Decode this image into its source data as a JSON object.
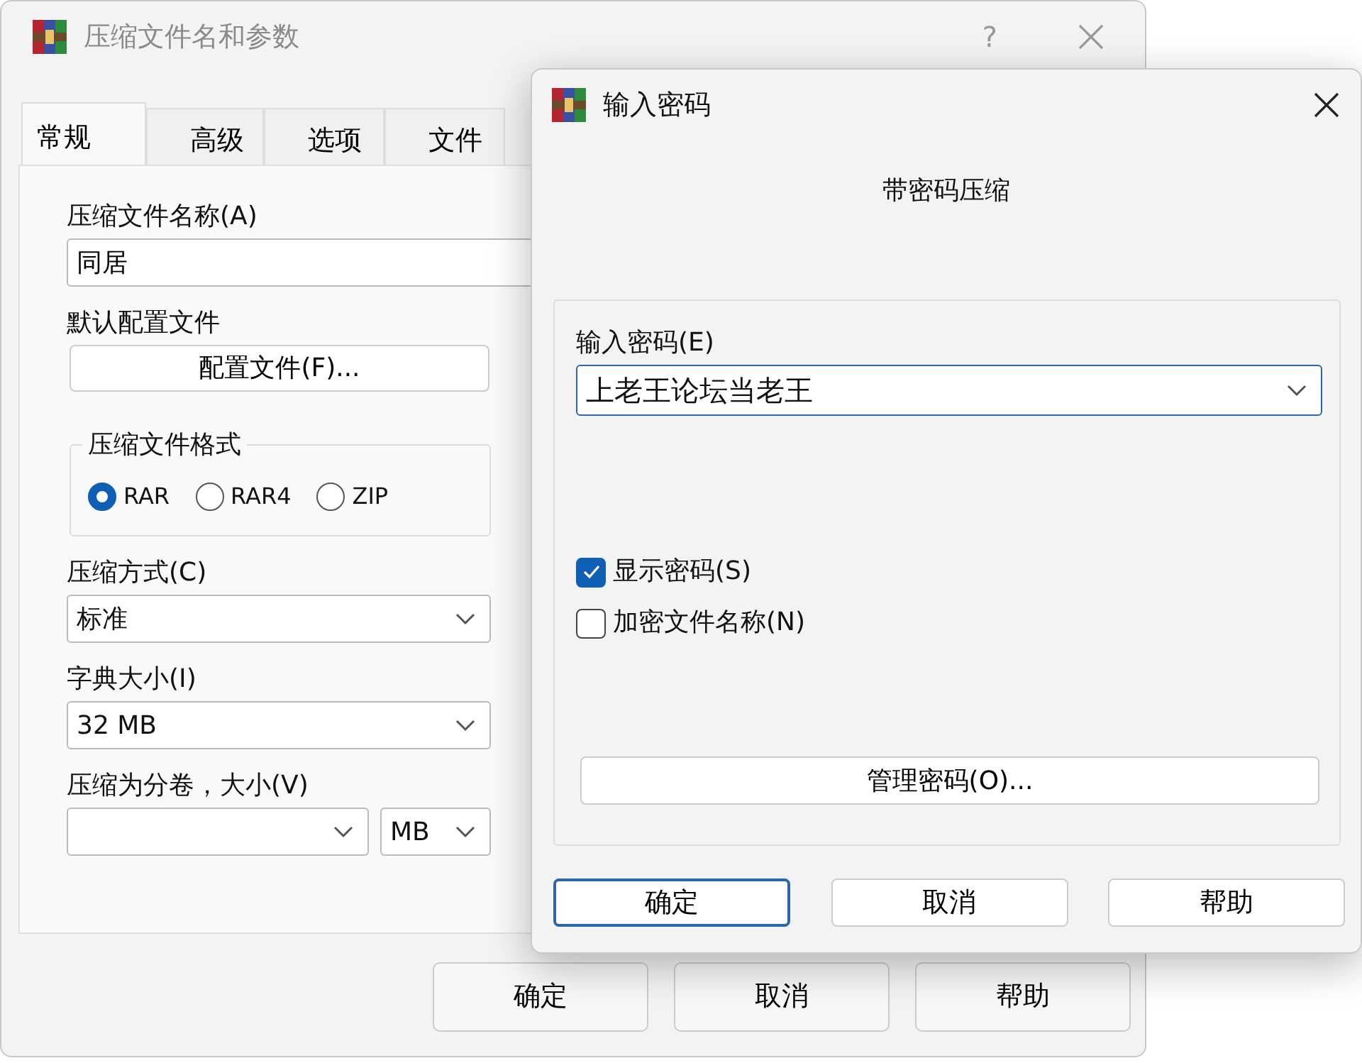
{
  "main_window": {
    "title": "压缩文件名和参数",
    "help_button": "?",
    "tabs": [
      {
        "label": "常规",
        "selected": true
      },
      {
        "label": "高级",
        "selected": false
      },
      {
        "label": "选项",
        "selected": false
      },
      {
        "label": "文件",
        "selected": false
      }
    ],
    "archive_name": {
      "label": "压缩文件名称(A)",
      "value": "同居"
    },
    "profiles": {
      "label": "默认配置文件",
      "button": "配置文件(F)..."
    },
    "format": {
      "legend": "压缩文件格式",
      "options": [
        {
          "label": "RAR",
          "selected": true
        },
        {
          "label": "RAR4",
          "selected": false
        },
        {
          "label": "ZIP",
          "selected": false
        }
      ]
    },
    "method": {
      "label": "压缩方式(C)",
      "value": "标准"
    },
    "dictionary": {
      "label": "字典大小(I)",
      "value": "32 MB"
    },
    "split": {
      "label": "压缩为分卷，大小(V)",
      "unit": "MB"
    },
    "buttons": [
      {
        "label": "确定",
        "default": false
      },
      {
        "label": "取消",
        "default": false
      },
      {
        "label": "帮助",
        "default": false
      }
    ]
  },
  "password_dialog": {
    "title": "输入密码",
    "heading": "带密码压缩",
    "password": {
      "label": "输入密码(E)",
      "value": "上老王论坛当老王"
    },
    "checkboxes": [
      {
        "label": "显示密码(S)",
        "checked": true
      },
      {
        "label": "加密文件名称(N)",
        "checked": false
      }
    ],
    "manage_button": "管理密码(O)...",
    "buttons": [
      {
        "label": "确定",
        "default": true
      },
      {
        "label": "取消",
        "default": false
      },
      {
        "label": "帮助",
        "default": false
      }
    ]
  }
}
